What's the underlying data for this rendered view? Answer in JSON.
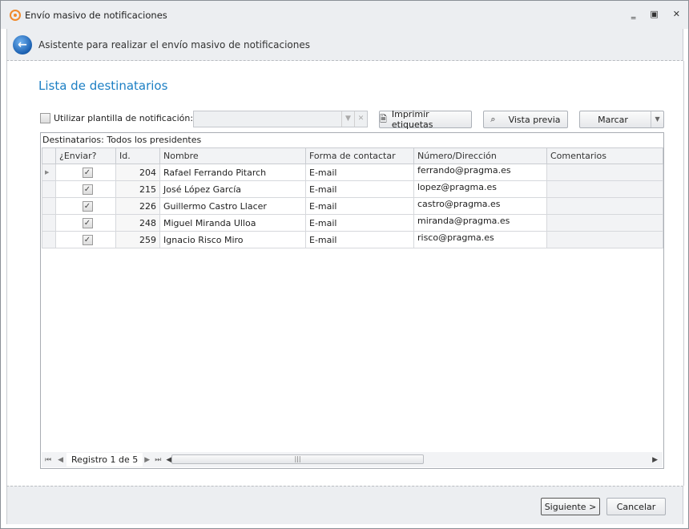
{
  "window": {
    "title": "Envío masivo de notificaciones",
    "minimize": "‗",
    "restore": "▣",
    "close": "✕"
  },
  "header": {
    "title": "Asistente para realizar el envío masivo de notificaciones"
  },
  "page_title": "Lista de destinatarios",
  "toolbar": {
    "template_label": "Utilizar plantilla de notificación:",
    "template_value": "",
    "print_labels": "Imprimir etiquetas",
    "preview": "Vista previa",
    "mark": "Marcar"
  },
  "grid": {
    "caption": "Destinatarios: Todos los presidentes",
    "columns": [
      "¿Enviar?",
      "Id.",
      "Nombre",
      "Forma de contactar",
      "Número/Dirección",
      "Comentarios"
    ],
    "rows": [
      {
        "send": true,
        "id": "204",
        "name": "Rafael Ferrando Pitarch",
        "contact": "E-mail",
        "address": "ferrando@pragma.es",
        "comments": ""
      },
      {
        "send": true,
        "id": "215",
        "name": "José López García",
        "contact": "E-mail",
        "address": "lopez@pragma.es",
        "comments": ""
      },
      {
        "send": true,
        "id": "226",
        "name": "Guillermo Castro Llacer",
        "contact": "E-mail",
        "address": "castro@pragma.es",
        "comments": ""
      },
      {
        "send": true,
        "id": "248",
        "name": "Miguel Miranda Ulloa",
        "contact": "E-mail",
        "address": "miranda@pragma.es",
        "comments": ""
      },
      {
        "send": true,
        "id": "259",
        "name": "Ignacio Risco Miro",
        "contact": "E-mail",
        "address": "risco@pragma.es",
        "comments": ""
      }
    ],
    "record_label": "Registro 1 de 5"
  },
  "footer": {
    "next": "Siguiente >",
    "cancel": "Cancelar"
  }
}
